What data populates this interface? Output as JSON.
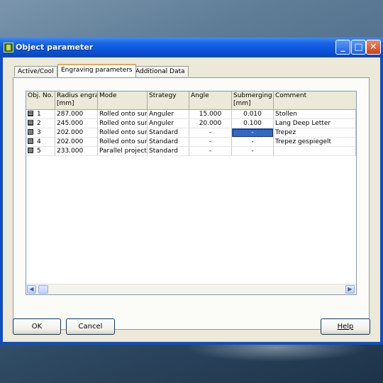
{
  "window": {
    "title": "Object parameter",
    "minimize_glyph": "_",
    "maximize_glyph": "□",
    "close_glyph": "✕"
  },
  "tabs": [
    {
      "label": "Active/Cool",
      "active": false
    },
    {
      "label": "Engraving parameters",
      "active": true
    },
    {
      "label": "Additional Data",
      "active": false
    }
  ],
  "table": {
    "headers": [
      "Obj. No.",
      "Radius engra\n[mm]",
      "Mode",
      "Strategy",
      "Angle",
      "Submerging\n[mm]",
      "Comment"
    ],
    "rows": [
      {
        "no": "1",
        "icon": "grid-icon",
        "radius": "287.000",
        "mode": "Rolled onto surf",
        "strategy": "Anguler",
        "angle": "15.000",
        "submerging": "0.010",
        "comment": "Stollen"
      },
      {
        "no": "2",
        "icon": "grid-icon",
        "radius": "245.000",
        "mode": "Rolled onto surf",
        "strategy": "Anguler",
        "angle": "20.000",
        "submerging": "0.100",
        "comment": "Lang Deep Letter"
      },
      {
        "no": "3",
        "icon": "dotted-grid-icon",
        "radius": "202.000",
        "mode": "Rolled onto surf",
        "strategy": "Standard",
        "angle": "-",
        "submerging": "-",
        "comment": "Trepez"
      },
      {
        "no": "4",
        "icon": "dotted-grid-icon",
        "radius": "202.000",
        "mode": "Rolled onto surf",
        "strategy": "Standard",
        "angle": "-",
        "submerging": "-",
        "comment": "Trepez gespiegelt"
      },
      {
        "no": "5",
        "icon": "dotted-grid-icon",
        "radius": "233.000",
        "mode": "Parallel projecti",
        "strategy": "Standard",
        "angle": "-",
        "submerging": "-",
        "comment": ""
      }
    ],
    "selected_cell": {
      "row": 2,
      "column": "submerging"
    }
  },
  "scrollbar": {
    "left_glyph": "◀",
    "right_glyph": "▶"
  },
  "buttons": {
    "ok": "OK",
    "cancel": "Cancel",
    "help": "Help"
  },
  "colors": {
    "titlebar": "#0a51d6",
    "selection": "#316ac5",
    "dialog_face": "#ece9d8"
  }
}
